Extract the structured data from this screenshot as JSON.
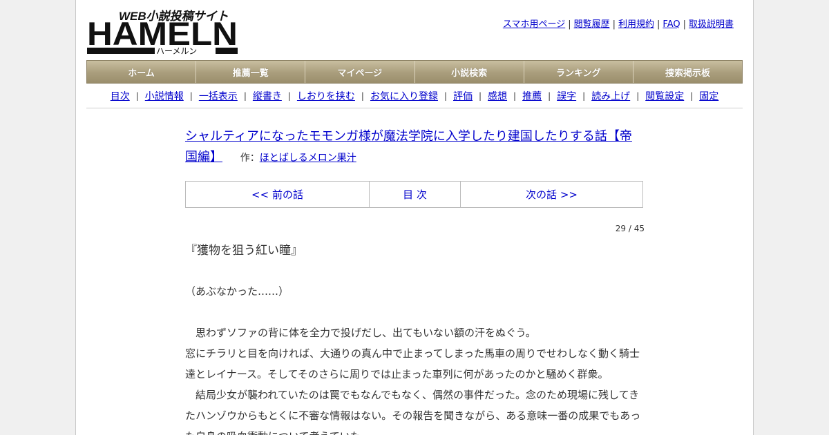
{
  "logo": {
    "tagline": "WEB小説投稿サイト",
    "wordmark": "HAMELN",
    "reading": "ハーメルン"
  },
  "toplinks": [
    {
      "label": "スマホ用ページ"
    },
    {
      "label": "閲覧履歴"
    },
    {
      "label": "利用規約"
    },
    {
      "label": "FAQ"
    },
    {
      "label": "取扱説明書"
    }
  ],
  "gnav": [
    {
      "label": "ホーム"
    },
    {
      "label": "推薦一覧"
    },
    {
      "label": "マイページ"
    },
    {
      "label": "小説検索"
    },
    {
      "label": "ランキング"
    },
    {
      "label": "捜索掲示板"
    }
  ],
  "subnav": [
    {
      "label": "目次"
    },
    {
      "label": "小説情報"
    },
    {
      "label": "一括表示"
    },
    {
      "label": "縦書き"
    },
    {
      "label": "しおりを挟む"
    },
    {
      "label": "お気に入り登録"
    },
    {
      "label": "評価"
    },
    {
      "label": "感想"
    },
    {
      "label": "推薦"
    },
    {
      "label": "誤字"
    },
    {
      "label": "読み上げ"
    },
    {
      "label": "閲覧設定"
    },
    {
      "label": "固定"
    }
  ],
  "novel": {
    "title": "シャルティアになったモモンガ様が魔法学院に入学したり建国したりする話【帝国編】",
    "author_prefix": "作：",
    "author": "ほとばしるメロン果汁"
  },
  "pager": {
    "prev": "<< 前の話",
    "toc": "目 次",
    "next": "次の話 >>"
  },
  "page_count": "29 / 45",
  "chapter_title": "『獲物を狙う紅い瞳』",
  "body": {
    "p1": "（あぶなかった……）",
    "p2": "　思わずソファの背に体を全力で投げだし、出てもいない額の汗をぬぐう。",
    "p3": "窓にチラリと目を向ければ、大通りの真ん中で止まってしまった馬車の周りでせわしなく動く騎士達とレイナース。そしてそのさらに周りでは止まった車列に何があったのかと騒めく群衆。",
    "p4": "　結局少女が襲われていたのは罠でもなんでもなく、偶然の事件だった。念のため現場に残してきたハンゾウからもとくに不審な情報はない。その報告を聞きながら、ある意味一番の成果でもあった自身の吸血衝動について考えていた。"
  },
  "colors": {
    "link": "#0000cc",
    "nav_bar": "#a99d7c",
    "page_bg": "#f0f0f0"
  }
}
